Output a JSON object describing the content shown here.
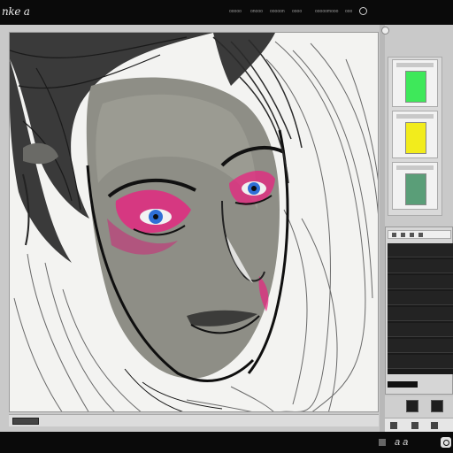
{
  "app": {
    "logo_text": "nke a"
  },
  "menu": {
    "items": [
      {
        "label": "ooooo"
      },
      {
        "label": "onooo"
      },
      {
        "label": "ooooon"
      },
      {
        "label": "oooo"
      },
      {
        "label": "ooooomooo"
      },
      {
        "label": "ooo"
      }
    ]
  },
  "panels": {
    "swatches": [
      {
        "color": "#3ee85a"
      },
      {
        "color": "#f2ec1c"
      },
      {
        "color": "#5a9e78"
      }
    ]
  },
  "statusbar": {
    "label": "a a"
  },
  "artwork": {
    "subject": "sketched portrait",
    "accent_colors": [
      "#e8237f",
      "#2f6fd6",
      "#7c2e5e"
    ],
    "skin_color": "#8f8f86",
    "line_color": "#141414"
  }
}
